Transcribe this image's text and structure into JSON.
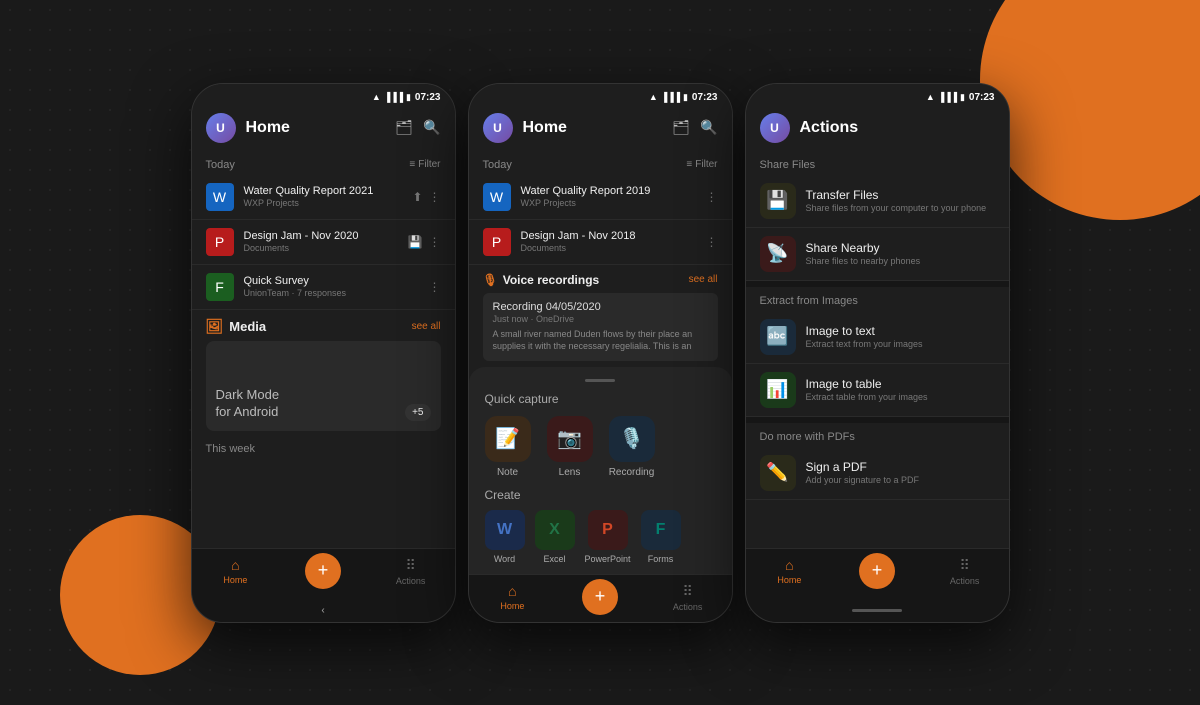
{
  "background": {
    "color": "#1a1a1a"
  },
  "phones": {
    "left": {
      "statusBar": {
        "time": "07:23"
      },
      "header": {
        "title": "Home",
        "avatarInitial": "U"
      },
      "todaySection": {
        "label": "Today",
        "filterLabel": "Filter"
      },
      "files": [
        {
          "name": "Water Quality Report 2021",
          "sub": "WXP Projects",
          "type": "word"
        },
        {
          "name": "Design Jam - Nov 2020",
          "sub": "Documents",
          "type": "ppt"
        },
        {
          "name": "Quick Survey",
          "sub": "UnionTeam · 7 responses",
          "type": "forms"
        }
      ],
      "mediaSection": {
        "title": "Media",
        "seeAll": "see all",
        "thumbText": "Dark Mode",
        "thumbSubText": "for Android",
        "badge": "+5"
      },
      "thisWeek": "This week",
      "nav": {
        "home": "Home",
        "add": "+",
        "actions": "Actions"
      }
    },
    "center": {
      "statusBar": {
        "time": "07:23"
      },
      "header": {
        "title": "Home"
      },
      "todaySection": {
        "label": "Today",
        "filterLabel": "Filter"
      },
      "files": [
        {
          "name": "Water Quality Report 2019",
          "sub": "WXP Projects",
          "type": "word"
        },
        {
          "name": "Design Jam - Nov 2018",
          "sub": "Documents",
          "type": "ppt"
        }
      ],
      "voiceSection": {
        "title": "Voice recordings",
        "seeAll": "see all",
        "recording": {
          "title": "Recording 04/05/2020",
          "meta": "Just now · OneDrive",
          "preview": "A small river named Duden flows by their place an supplies it with the necessary regelialia. This is an"
        }
      },
      "quickCapture": {
        "title": "Quick capture",
        "items": [
          {
            "label": "Note",
            "icon": "📝",
            "iconClass": "qc-icon-note"
          },
          {
            "label": "Lens",
            "icon": "📷",
            "iconClass": "qc-icon-lens"
          },
          {
            "label": "Recording",
            "icon": "🎙️",
            "iconClass": "qc-icon-rec"
          }
        ],
        "createLabel": "Create",
        "createItems": [
          {
            "label": "Word",
            "icon": "W",
            "iconClass": "qc-create-word",
            "color": "#4472C4"
          },
          {
            "label": "Excel",
            "icon": "X",
            "iconClass": "qc-create-excel",
            "color": "#217346"
          },
          {
            "label": "PowerPoint",
            "icon": "P",
            "iconClass": "qc-create-ppt",
            "color": "#D24726"
          },
          {
            "label": "Forms",
            "icon": "F",
            "iconClass": "qc-create-forms",
            "color": "#037F6E"
          }
        ]
      },
      "nav": {
        "home": "Home",
        "add": "+",
        "actions": "Actions"
      }
    },
    "right": {
      "statusBar": {
        "time": "07:23"
      },
      "header": {
        "title": "Actions"
      },
      "sections": [
        {
          "title": "Share Files",
          "items": [
            {
              "name": "Transfer Files",
              "desc": "Share files from your computer to your phone",
              "iconClass": "action-icon-transfer",
              "icon": "💾"
            },
            {
              "name": "Share Nearby",
              "desc": "Share files to nearby phones",
              "iconClass": "action-icon-share",
              "icon": "📡"
            }
          ]
        },
        {
          "title": "Extract from Images",
          "items": [
            {
              "name": "Image to text",
              "desc": "Extract text from your images",
              "iconClass": "action-icon-img2txt",
              "icon": "🔤"
            },
            {
              "name": "Image to table",
              "desc": "Extract table from your images",
              "iconClass": "action-icon-img2tbl",
              "icon": "📊"
            }
          ]
        },
        {
          "title": "Do more with PDFs",
          "items": [
            {
              "name": "Sign a PDF",
              "desc": "Add your signature to a PDF",
              "iconClass": "action-icon-sign",
              "icon": "✏️"
            }
          ]
        }
      ],
      "nav": {
        "home": "Home",
        "add": "+",
        "actions": "Actions"
      }
    }
  }
}
